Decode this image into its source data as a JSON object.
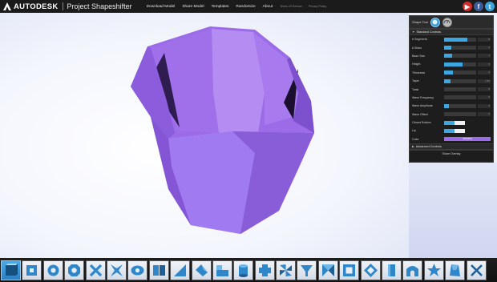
{
  "header": {
    "brand": "AUTODESK",
    "product": "Project Shapeshifter",
    "nav": [
      "Download Model",
      "Share Model",
      "Templates",
      "Randomize",
      "About"
    ],
    "nav_small": [
      "Terms Of Service",
      "Privacy Policy"
    ],
    "social": [
      {
        "icon": "youtube-icon",
        "glyph": "▶",
        "color": "#d62b2b"
      },
      {
        "icon": "facebook-icon",
        "glyph": "f",
        "color": "#3b5a98"
      },
      {
        "icon": "twitter-icon",
        "glyph": "t",
        "color": "#38a6dc"
      }
    ]
  },
  "panel": {
    "shape_tool_label": "Shape Tool",
    "standard_controls_label": "Standard Controls",
    "controls": [
      {
        "label": "# Segments",
        "fill": 0.72,
        "value": "8"
      },
      {
        "label": "# Sides",
        "fill": 0.22,
        "value": "4"
      },
      {
        "label": "Base Size",
        "fill": 0.24,
        "value": "1"
      },
      {
        "label": "Height",
        "fill": 0.58,
        "value": "5"
      },
      {
        "label": "Thickness",
        "fill": 0.28,
        "value": "3"
      },
      {
        "label": "Taper",
        "fill": 0.2,
        "value": "1.25"
      },
      {
        "label": "Twist",
        "fill": 0.0,
        "value": "0"
      },
      {
        "label": "Wave Frequency",
        "fill": 0.0,
        "value": "0"
      },
      {
        "label": "Wave Amplitude",
        "fill": 0.15,
        "value": "0"
      },
      {
        "label": "Wave Offset",
        "fill": 0.0,
        "value": "0"
      }
    ],
    "closed_bottom_label": "Closed Bottom",
    "lip_label": "Lip",
    "color_label": "Color",
    "color_value": "#9B6BE8",
    "color_text": "#9B6BE8",
    "advanced_controls_label": "Advanced Controls",
    "footer_label": "Share Overlay"
  },
  "colors": {
    "accent": "#3fa7e0",
    "shape": "#9b6be8"
  },
  "shape_bar": {
    "active_index": 0,
    "icons": [
      "cube-icon",
      "hollow-square-icon",
      "ring-icon",
      "octagon-ring-icon",
      "x-icon",
      "star-x-icon",
      "eye-icon",
      "split-block-icon",
      "wedge-icon",
      "twisted-wedge-icon",
      "half-block-icon",
      "cylinder-icon",
      "cross-block-icon",
      "pinwheel-icon",
      "funnel-icon",
      "bowtie-icon",
      "frame-icon",
      "tilted-frame-icon",
      "column-icon",
      "arch-block-icon",
      "star-block-icon",
      "twisted-tower-icon",
      "cross-icon"
    ]
  }
}
